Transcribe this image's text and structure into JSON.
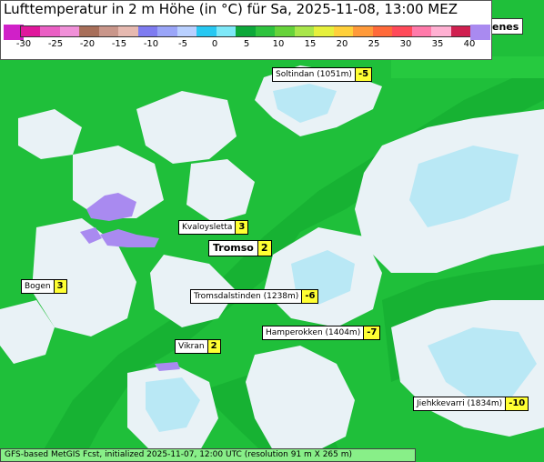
{
  "title": "Lufttemperatur in 2 m Höhe (in °C) für Sa, 2025-11-08, 13:00 MEZ",
  "legend": {
    "ticks": [
      "-30",
      "-25",
      "-20",
      "-15",
      "-10",
      "-5",
      "0",
      "5",
      "10",
      "15",
      "20",
      "25",
      "30",
      "35",
      "40"
    ],
    "colors": [
      "#e0179c",
      "#ea5fc4",
      "#f090d8",
      "#a86f5a",
      "#c9968a",
      "#e6b9b0",
      "#7e7bf0",
      "#9aa5f8",
      "#b9d0ff",
      "#27c8f2",
      "#7ee8f8",
      "#0da83a",
      "#2ec33e",
      "#66d33a",
      "#a9e64a",
      "#e6f03c",
      "#ffd03a",
      "#ff9a3a",
      "#ff6a3a",
      "#ff4a5a",
      "#ff7aaa",
      "#ffb0d2",
      "#d02050"
    ],
    "low_color": "#d020c8",
    "high_color": "#a98af0"
  },
  "right_tab_text": "enes",
  "places": [
    {
      "name": "Soltindan (1051m)",
      "value": "-5"
    },
    {
      "name": "Kvaloysletta",
      "value": "3"
    },
    {
      "name": "Tromso",
      "value": "2"
    },
    {
      "name": "Bogen",
      "value": "3"
    },
    {
      "name": "Tromsdalstinden (1238m)",
      "value": "-6"
    },
    {
      "name": "Hamperokken (1404m)",
      "value": "-7"
    },
    {
      "name": "Vikran",
      "value": "2"
    },
    {
      "name": "Jiehkkevarri (1834m)",
      "value": "-10"
    }
  ],
  "footer": "GFS-based MetGIS Fcst, initialized 2025-11-07, 12:00 UTC  (resolution 91 m X 265 m)",
  "colors": {
    "lowland_green": "#1fbf3a",
    "fjord_green": "#17b233",
    "mountain_white": "#eef4f8",
    "mountain_ice": "#b9e8f5",
    "cold_purple": "#a98af0",
    "label_value_yellow": "#ffff33"
  }
}
